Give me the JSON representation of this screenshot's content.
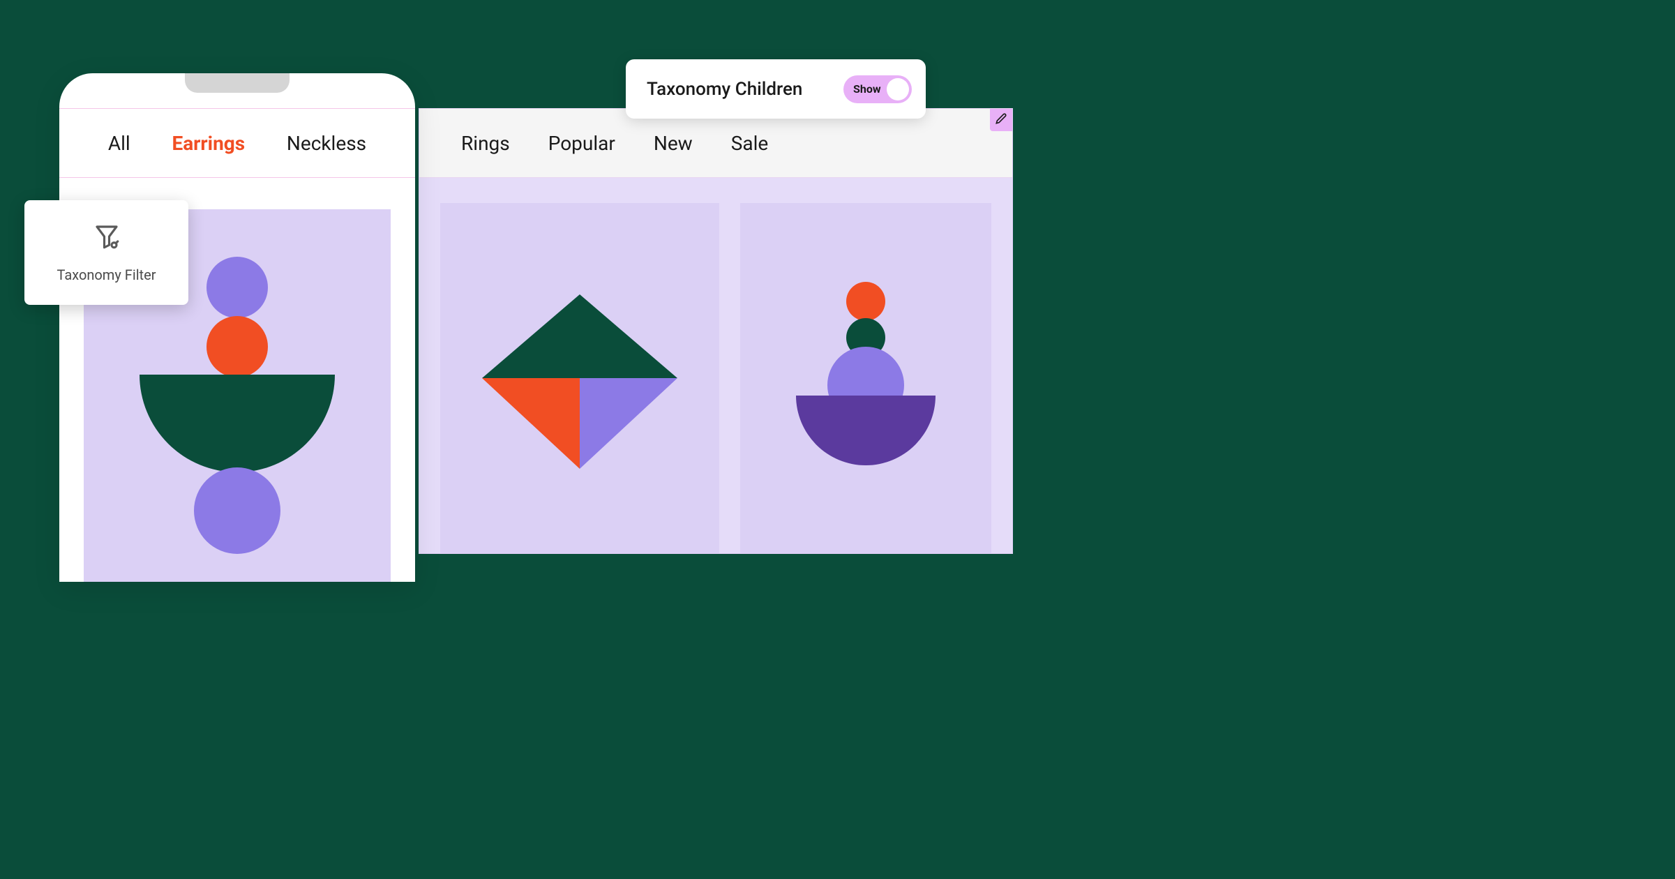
{
  "settings": {
    "label": "Taxonomy Children",
    "toggle_label": "Show"
  },
  "desktop_nav": {
    "items": [
      "Rings",
      "Popular",
      "New",
      "Sale"
    ]
  },
  "mobile_nav": {
    "items": [
      {
        "label": "All",
        "active": false
      },
      {
        "label": "Earrings",
        "active": true
      },
      {
        "label": "Neckless",
        "active": false
      }
    ]
  },
  "filter": {
    "label": "Taxonomy Filter"
  },
  "colors": {
    "bg": "#0a4d3a",
    "accent": "#f14e23",
    "toggle": "#e8b0f7",
    "card_bg": "#dbd0f5",
    "purple": "#8c7ae6",
    "dark_purple": "#5b3a9e",
    "green": "#0a4d3a"
  }
}
